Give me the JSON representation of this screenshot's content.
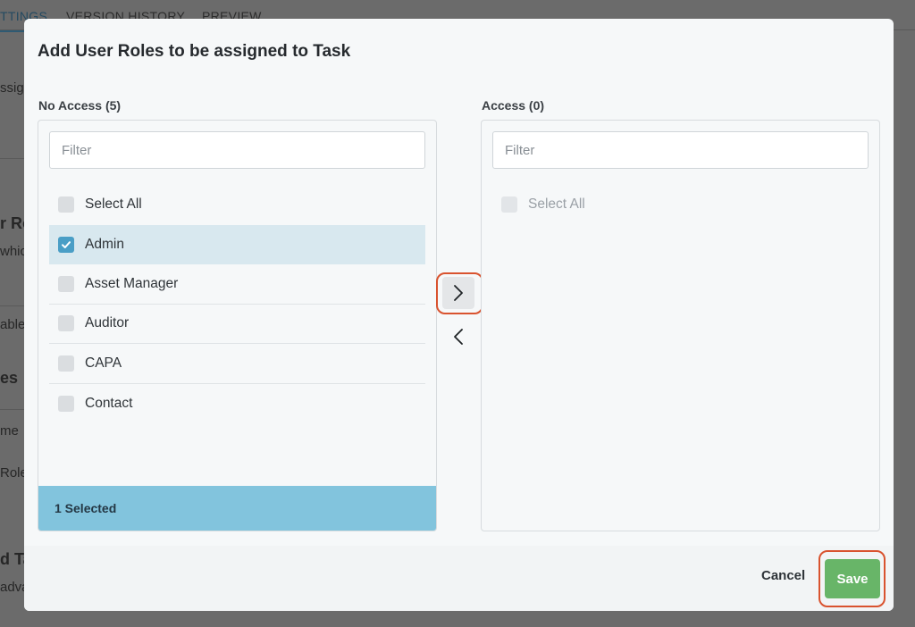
{
  "background": {
    "tabs": [
      "TTINGS",
      "VERSION HISTORY",
      "PREVIEW"
    ],
    "fragments": [
      "ssign",
      "r Ro",
      "whic",
      "able",
      "es",
      "me",
      "Role",
      "d Ta",
      "adva"
    ]
  },
  "modal": {
    "title": "Add User Roles to be assigned to Task",
    "no_access": {
      "label": "No Access (5)",
      "filter_placeholder": "Filter",
      "select_all": "Select All",
      "items": [
        {
          "label": "Admin",
          "checked": true
        },
        {
          "label": "Asset Manager",
          "checked": false
        },
        {
          "label": "Auditor",
          "checked": false
        },
        {
          "label": "CAPA",
          "checked": false
        },
        {
          "label": "Contact",
          "checked": false
        }
      ],
      "selected_count": "1 Selected"
    },
    "access": {
      "label": "Access (0)",
      "filter_placeholder": "Filter",
      "select_all": "Select All"
    },
    "icons": {
      "move_right": "chevron-right-icon",
      "move_left": "chevron-left-icon",
      "check": "check-icon"
    },
    "footer": {
      "cancel": "Cancel",
      "save": "Save"
    }
  },
  "colors": {
    "accent": "#4a9ec6",
    "selected_bar": "#82c4dd",
    "save": "#68b568",
    "highlight": "#d9532f"
  }
}
